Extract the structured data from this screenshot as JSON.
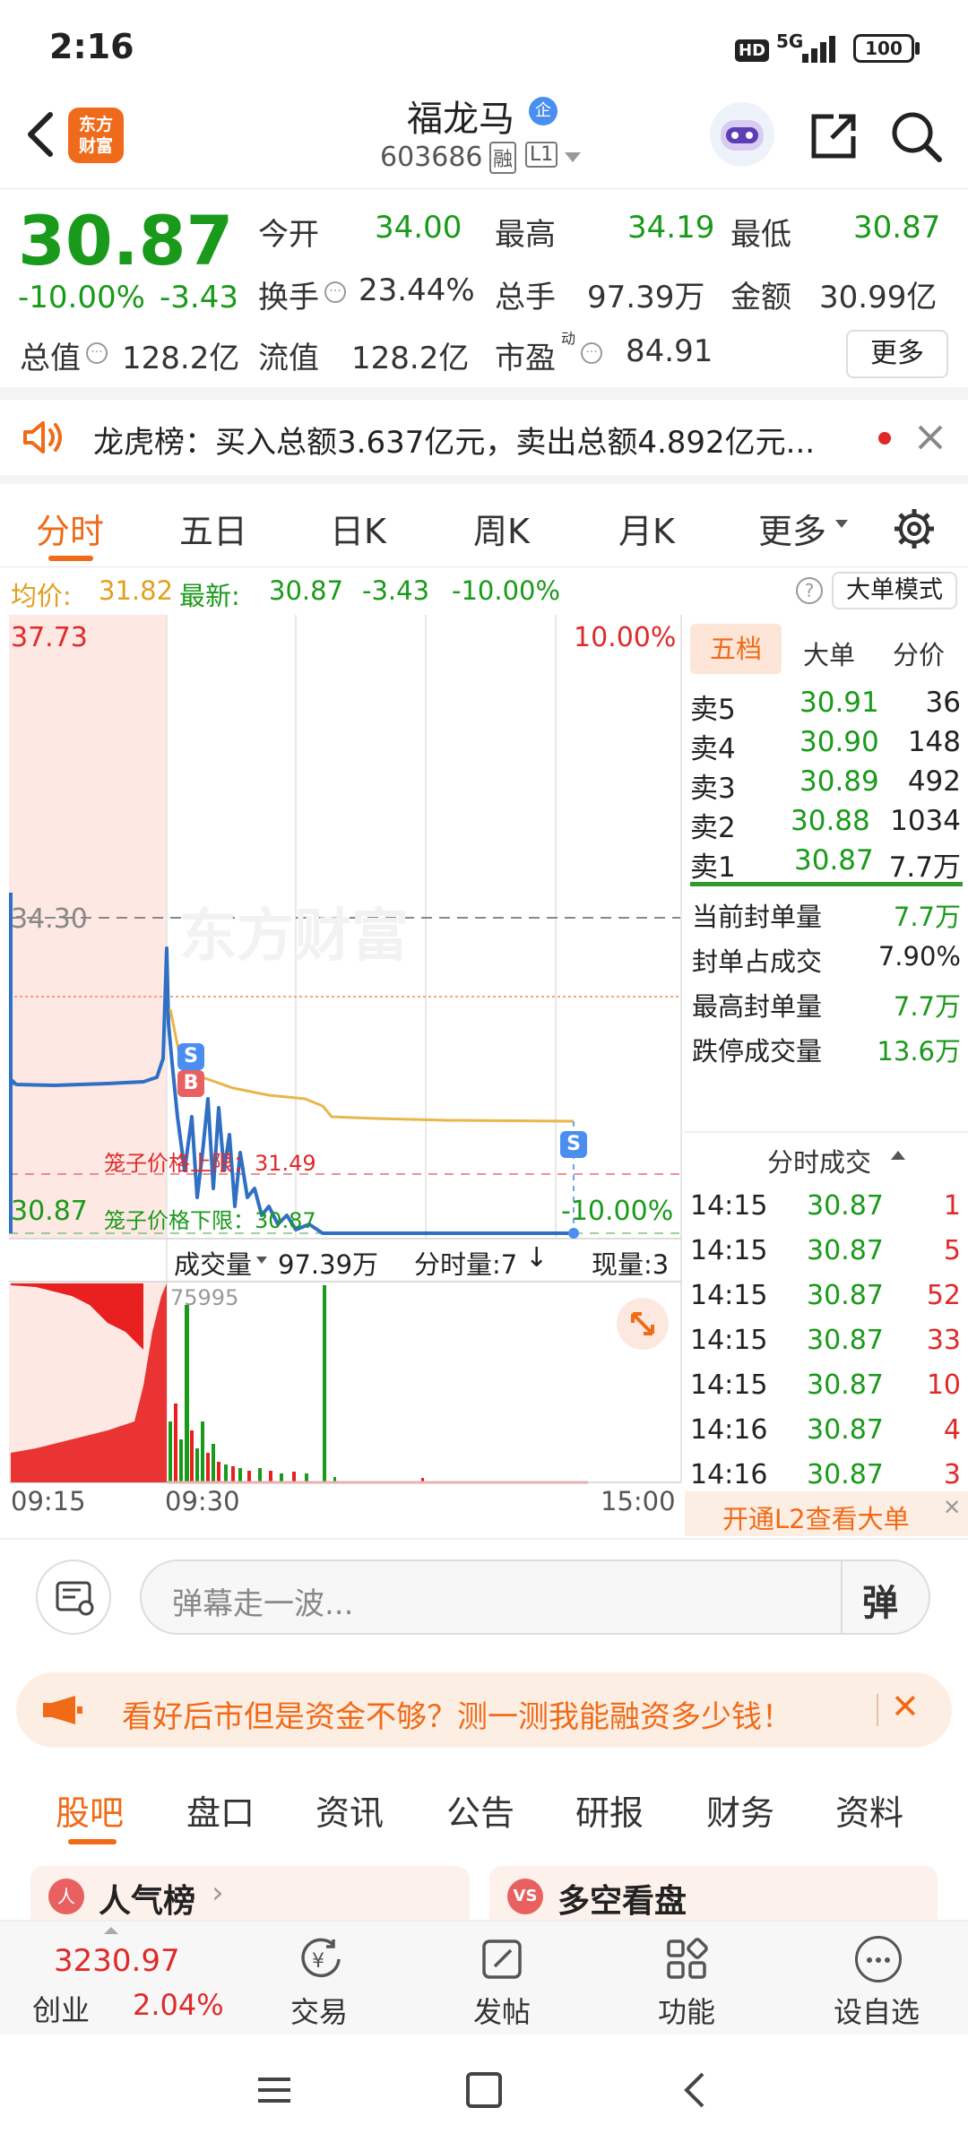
{
  "status": {
    "time": "2:16",
    "hd": "HD",
    "net": "5G",
    "battery": "100"
  },
  "header": {
    "name": "福龙马",
    "enterprise_badge": "企",
    "code": "603686",
    "margin_badge": "融",
    "level_badge": "L1",
    "logo_line1": "东方",
    "logo_line2": "财富"
  },
  "quote": {
    "price": "30.87",
    "pct": "-10.00%",
    "change": "-3.43",
    "items": [
      {
        "label": "今开",
        "value": "34.00"
      },
      {
        "label": "最高",
        "value": "34.19"
      },
      {
        "label": "最低",
        "value": "30.87"
      },
      {
        "label": "换手",
        "value": "23.44%"
      },
      {
        "label": "总手",
        "value": "97.39万"
      },
      {
        "label": "金额",
        "value": "30.99亿"
      },
      {
        "label": "总值",
        "value": "128.2亿"
      },
      {
        "label": "流值",
        "value": "128.2亿"
      },
      {
        "label": "市盈",
        "value": "84.91"
      }
    ],
    "pe_sup": "动",
    "more_label": "更多"
  },
  "notice": {
    "text": "龙虎榜：买入总额3.637亿元，卖出总额4.892亿元..."
  },
  "tabs": [
    {
      "label": "分时",
      "active": true
    },
    {
      "label": "五日",
      "active": false
    },
    {
      "label": "日K",
      "active": false
    },
    {
      "label": "周K",
      "active": false
    },
    {
      "label": "月K",
      "active": false
    },
    {
      "label": "更多",
      "active": false
    }
  ],
  "infobar": {
    "avg_label": "均价:",
    "avg": "31.82",
    "latest_label": "最新:",
    "latest": "30.87",
    "change": "-3.43",
    "pct": "-10.00%",
    "help": "?",
    "mode_button": "大单模式"
  },
  "chart": {
    "y_top": "37.73",
    "y_mid": "34.30",
    "y_bottom": "30.87",
    "pct_top": "10.00%",
    "pct_bottom": "-10.00%",
    "cage_upper": "笼子价格上限：31.49",
    "cage_lower": "笼子价格下限：30.87",
    "watermark": "东方财富",
    "marker_s": "S",
    "marker_b": "B",
    "vol_label": "成交量",
    "vol_value": "97.39万",
    "interval": "分时量:7",
    "current_vol": "现量:3",
    "vol_peak": "75995",
    "x_labels": [
      "09:15",
      "09:30",
      "15:00"
    ]
  },
  "chart_data": {
    "type": "line",
    "title": "",
    "x": [
      "09:15",
      "09:30",
      "15:00"
    ],
    "ylim": [
      30.87,
      37.73
    ],
    "series": [
      {
        "values": [
          34.2,
          34.3,
          34.13,
          31.9,
          31.3,
          31.1,
          30.87
        ]
      },
      {
        "values": [
          33.9,
          33.2,
          32.4,
          31.96,
          31.88,
          31.82
        ]
      }
    ],
    "volume_peak": 75995
  },
  "orderbook": {
    "tabs": [
      "五档",
      "大单",
      "分价"
    ],
    "asks": [
      {
        "label": "卖5",
        "price": "30.91",
        "vol": "36"
      },
      {
        "label": "卖4",
        "price": "30.90",
        "vol": "148"
      },
      {
        "label": "卖3",
        "price": "30.89",
        "vol": "492"
      },
      {
        "label": "卖2",
        "price": "30.88",
        "vol": "1034"
      },
      {
        "label": "卖1",
        "price": "30.87",
        "vol": "7.7万"
      }
    ],
    "stats": [
      {
        "label": "当前封单量",
        "value": "7.7万"
      },
      {
        "label": "封单占成交",
        "value": "7.90%"
      },
      {
        "label": "最高封单量",
        "value": "7.7万"
      },
      {
        "label": "跌停成交量",
        "value": "13.6万"
      }
    ],
    "ticks_header": "分时成交",
    "ticks": [
      {
        "time": "14:15",
        "price": "30.87",
        "vol": "1"
      },
      {
        "time": "14:15",
        "price": "30.87",
        "vol": "5"
      },
      {
        "time": "14:15",
        "price": "30.87",
        "vol": "52"
      },
      {
        "time": "14:15",
        "price": "30.87",
        "vol": "33"
      },
      {
        "time": "14:15",
        "price": "30.87",
        "vol": "10"
      },
      {
        "time": "14:16",
        "price": "30.87",
        "vol": "4"
      },
      {
        "time": "14:16",
        "price": "30.87",
        "vol": "3"
      }
    ],
    "l2_banner": "开通L2查看大单"
  },
  "danmu": {
    "placeholder": "弹幕走一波...",
    "button": "弹"
  },
  "ad": {
    "text": "看好后市但是资金不够？测一测我能融资多少钱！"
  },
  "bottom_tabs": [
    "股吧",
    "盘口",
    "资讯",
    "公告",
    "研报",
    "财务",
    "资料"
  ],
  "cards": [
    {
      "icon": "人",
      "title": "人气榜"
    },
    {
      "icon": "VS",
      "title": "多空看盘"
    }
  ],
  "bottom_nav": {
    "index_value": "3230.97",
    "index_name": "创业",
    "index_pct": "2.04%",
    "items": [
      "交易",
      "发帖",
      "功能",
      "设自选"
    ]
  },
  "colors": {
    "up": "#e02a2a",
    "down": "#1a9a1a",
    "accent": "#f06a17",
    "price_line": "#2f6fc4",
    "avg_line": "#e8b64a"
  }
}
